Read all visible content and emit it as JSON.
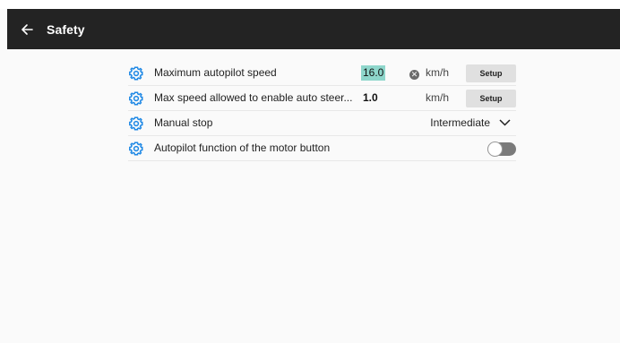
{
  "header": {
    "title": "Safety",
    "back_icon": "arrow-left-icon"
  },
  "colors": {
    "appbar": "#232323",
    "accent_icon": "#1e88e5",
    "value_highlight": "#8ed6cb",
    "setup_button": "#e0e0e0",
    "toggle_track": "#7a7a7a"
  },
  "settings": [
    {
      "icon": "gear-icon",
      "label": "Maximum autopilot speed",
      "value": "16.0",
      "unit": "km/h",
      "button": "Setup"
    },
    {
      "icon": "gear-icon",
      "label": "Max speed allowed to enable auto steer...",
      "value": "1.0",
      "unit": "km/h",
      "button": "Setup"
    },
    {
      "icon": "gear-icon",
      "label": "Manual stop",
      "selected": "Intermediate"
    },
    {
      "icon": "gear-icon",
      "label": "Autopilot function of the motor button",
      "toggle_on": false
    }
  ]
}
